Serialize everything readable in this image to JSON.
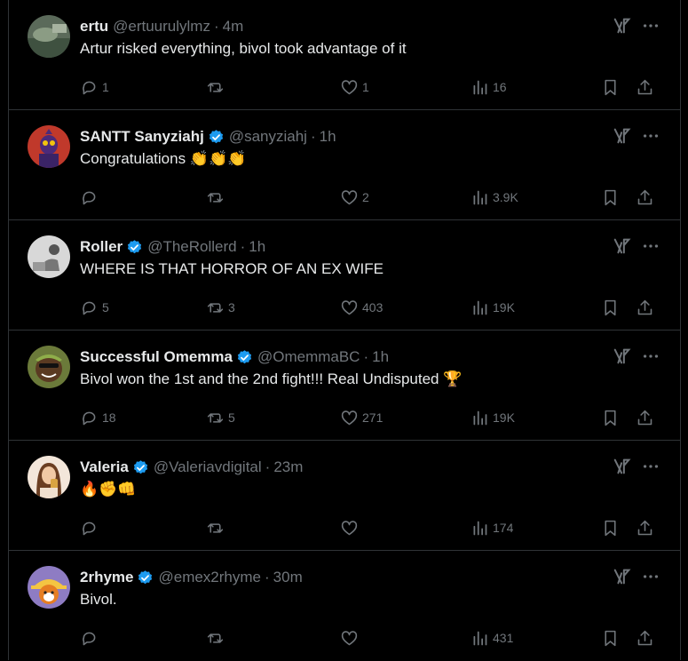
{
  "tweets": [
    {
      "name": "ertu",
      "verified": false,
      "handle": "@ertuurulylmz",
      "sep": "·",
      "time": "4m",
      "text": "Artur risked everything, bivol took advantage of it",
      "replies": "1",
      "reposts": "",
      "likes": "1",
      "views": "16"
    },
    {
      "name": "SANTT Sanyziahj",
      "verified": true,
      "handle": "@sanyziahj",
      "sep": "·",
      "time": "1h",
      "text": "Congratulations 👏👏👏",
      "replies": "",
      "reposts": "",
      "likes": "2",
      "views": "3.9K"
    },
    {
      "name": "Roller",
      "verified": true,
      "handle": "@TheRollerd",
      "sep": "·",
      "time": "1h",
      "text": "WHERE IS THAT HORROR OF AN EX WIFE",
      "replies": "5",
      "reposts": "3",
      "likes": "403",
      "views": "19K"
    },
    {
      "name": "Successful Omemma",
      "verified": true,
      "handle": "@OmemmaBC",
      "sep": "·",
      "time": "1h",
      "text": "Bivol won the 1st and the 2nd fight!!! Real Undisputed 🏆",
      "replies": "18",
      "reposts": "5",
      "likes": "271",
      "views": "19K"
    },
    {
      "name": "Valeria",
      "verified": true,
      "handle": "@Valeriavdigital",
      "sep": "·",
      "time": "23m",
      "text": "🔥✊👊",
      "replies": "",
      "reposts": "",
      "likes": "",
      "views": "174"
    },
    {
      "name": "2rhyme",
      "verified": true,
      "handle": "@emex2rhyme",
      "sep": "·",
      "time": "30m",
      "text": "Bivol.",
      "replies": "",
      "reposts": "",
      "likes": "",
      "views": "431"
    }
  ],
  "icons": {
    "reply": "reply-icon",
    "repost": "repost-icon",
    "like": "heart-icon",
    "views": "views-icon",
    "bookmark": "bookmark-icon",
    "share": "share-icon",
    "grok": "grok-icon",
    "more": "more-icon",
    "verified": "verified-badge-icon"
  },
  "colors": {
    "background": "#000000",
    "text": "#e7e9ea",
    "muted": "#71767b",
    "border": "#2f3336",
    "verified": "#1d9bf0"
  }
}
